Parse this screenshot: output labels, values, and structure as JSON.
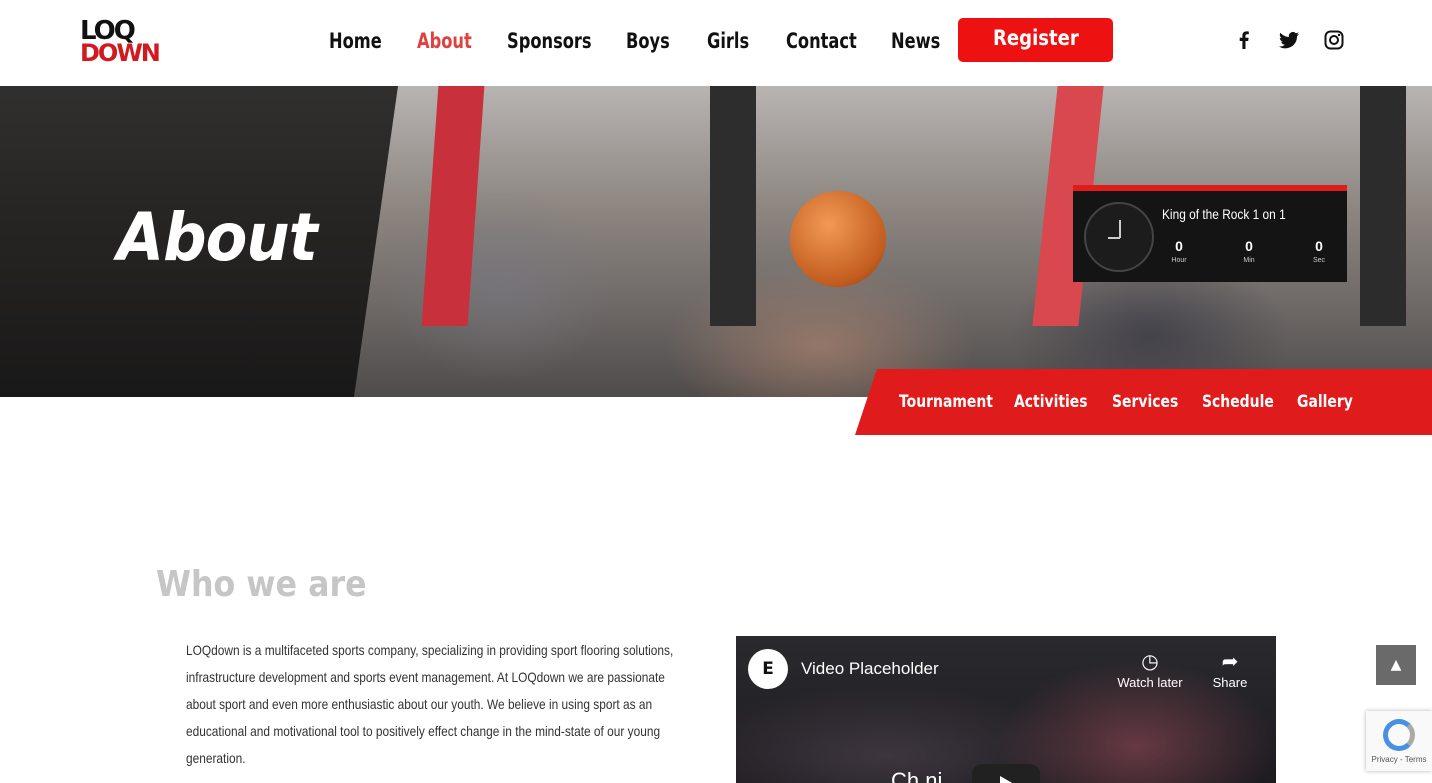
{
  "logo": {
    "line1": "LOQ",
    "line2": "DOWN"
  },
  "nav": {
    "items": [
      {
        "label": "Home"
      },
      {
        "label": "About"
      },
      {
        "label": "Sponsors"
      },
      {
        "label": "Boys"
      },
      {
        "label": "Girls"
      },
      {
        "label": "Contact"
      },
      {
        "label": "News"
      }
    ],
    "active": "About",
    "register_label": "Register"
  },
  "social": {
    "facebook": "f",
    "twitter": "t-icon",
    "instagram": "ig-icon"
  },
  "hero": {
    "title": "About",
    "countdown": {
      "title": "King of the Rock 1 on 1",
      "hour": "0",
      "hour_label": "Hour",
      "min": "0",
      "min_label": "Min",
      "sec": "0",
      "sec_label": "Sec"
    }
  },
  "subnav": {
    "items": [
      {
        "label": "Tournament"
      },
      {
        "label": "Activities"
      },
      {
        "label": "Services"
      },
      {
        "label": "Schedule"
      },
      {
        "label": "Gallery"
      }
    ]
  },
  "about": {
    "title": "Who we are",
    "body": "LOQdown is a multifaceted sports company, specializing in providing sport flooring solutions, infrastructure development and sports event management. At LOQdown we are passionate about sport and even more enthusiastic about our youth. We believe in using sport as an educational and motivational tool to positively effect change in the mind-state of our young generation."
  },
  "video": {
    "channel_icon": "E",
    "title": "Video Placeholder",
    "watch_later": "Watch later",
    "share": "Share",
    "overlay_text": "Ch                 ni"
  },
  "recaptcha": {
    "text": "Privacy - Terms"
  },
  "colors": {
    "accent": "#e01b1b",
    "nav_active": "#e0403f"
  }
}
